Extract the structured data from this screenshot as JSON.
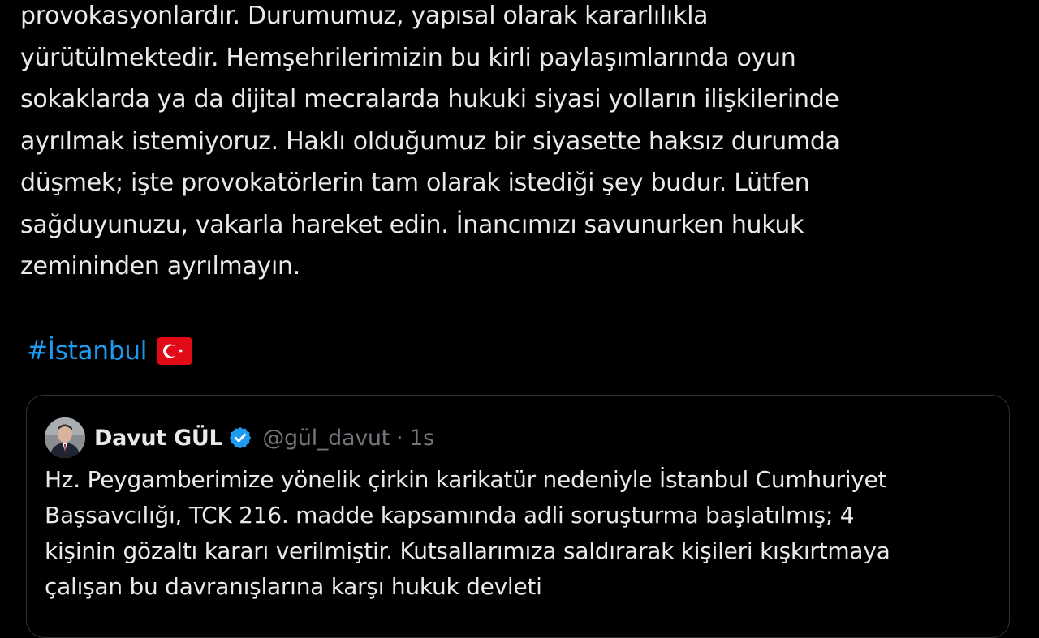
{
  "tweet": {
    "lines": [
      "provokasyonlardır. Durumumuz, yapısal olarak kararlılıkla",
      "yürütülmektedir. Hemşehrilerimizin bu kirli paylaşımlarında oyun",
      "sokaklarda ya da dijital mecralarda hukuki siyasi yolların ilişkilerinde",
      "ayrılmak istemiyoruz. Haklı olduğumuz bir siyasette haksız durumda",
      "düşmek; işte provokatörlerin tam olarak istediği şey budur. Lütfen",
      "sağduyunuzu, vakarla hareket edin. İnancımızı savunurken hukuk",
      "zemininden ayrılmayın."
    ],
    "hashtag": "#İstanbul",
    "flag_icon": "turkish-flag-emoji"
  },
  "quoted_tweet": {
    "author_name": "Davut GÜL",
    "handle": "@gül_davut",
    "separator": "·",
    "timestamp": "1s",
    "verified_icon": "verified-badge-icon",
    "lines": [
      "Hz. Peygamberimize yönelik çirkin karikatür nedeniyle İstanbul Cumhuriyet",
      "Başsavcılığı, TCK 216. madde kapsamında adli soruşturma başlatılmış; 4",
      "kişinin gözaltı kararı verilmiştir. Kutsallarımıza saldırarak kişileri kışkırtmaya",
      "çalışan bu davranışlarına karşı hukuk devleti"
    ]
  },
  "colors": {
    "background": "#000000",
    "text": "#e7e9ea",
    "secondary_text": "#71767b",
    "link": "#1d9bf0",
    "border": "#2f3336",
    "verified": "#1d9bf0",
    "flag_red": "#e30a17"
  }
}
